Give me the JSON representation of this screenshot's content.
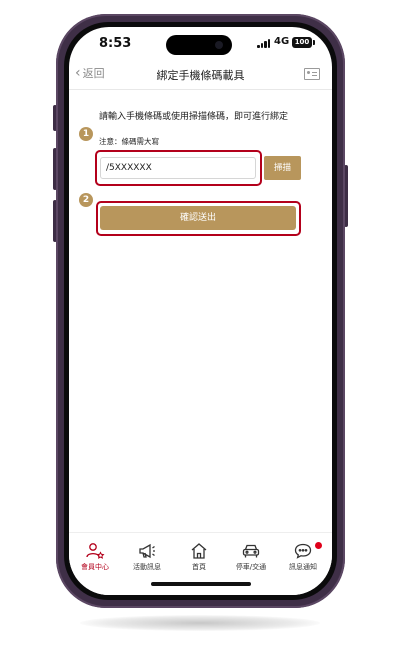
{
  "status_bar": {
    "time": "8:53",
    "network": "4G",
    "battery": "100"
  },
  "nav": {
    "back_label": "返回",
    "title": "綁定手機條碼載具"
  },
  "form": {
    "instructions": "請輸入手機條碼或使用掃描條碼，即可進行綁定",
    "note": "注意：條碼需大寫",
    "step1": "1",
    "step2": "2",
    "barcode_value": "/5XXXXXX",
    "scan_label": "掃描",
    "submit_label": "確認送出"
  },
  "tab_bar": {
    "items": [
      {
        "label": "會員中心",
        "icon": "member-icon",
        "active": true
      },
      {
        "label": "活動訊息",
        "icon": "megaphone-icon",
        "active": false
      },
      {
        "label": "首頁",
        "icon": "home-icon",
        "active": false
      },
      {
        "label": "停車/交通",
        "icon": "car-icon",
        "active": false
      },
      {
        "label": "訊息通知",
        "icon": "chat-bubble-icon",
        "active": false,
        "badge": true
      }
    ]
  },
  "colors": {
    "accent_gold": "#b8965c",
    "highlight_red": "#b3001b",
    "active_tab": "#b3001b",
    "badge_red": "#e0001a",
    "phone_frame": "#3f2f47"
  }
}
